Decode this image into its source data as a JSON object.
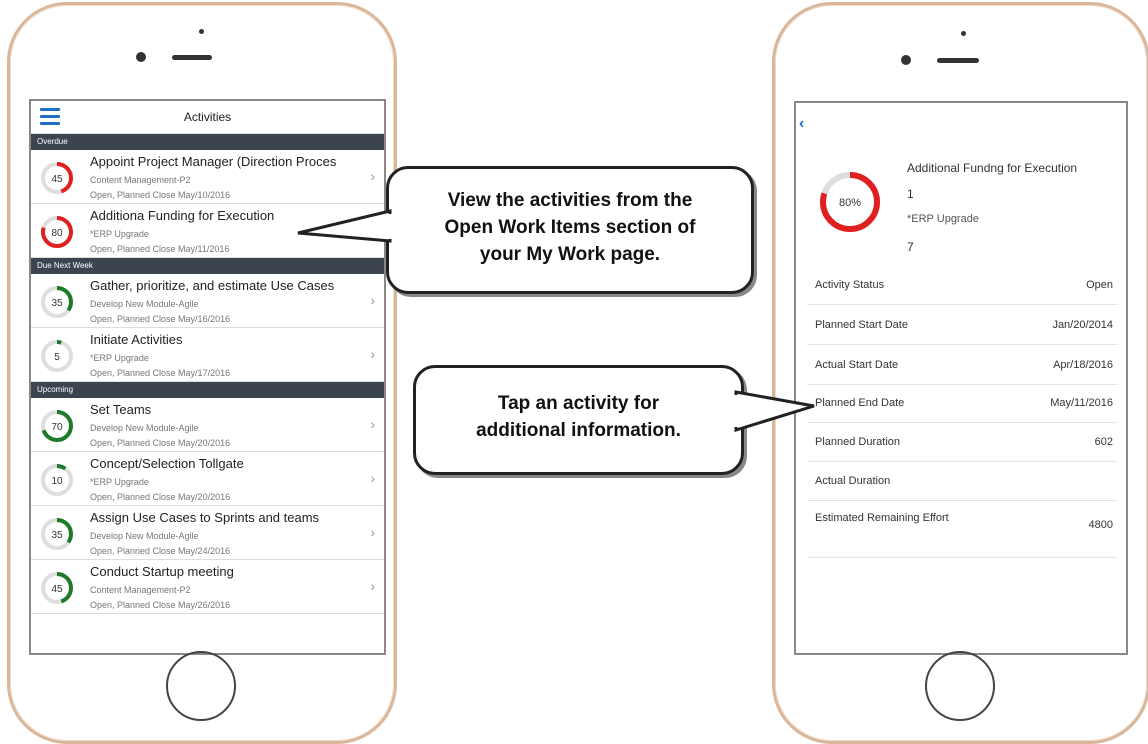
{
  "left_screen": {
    "title": "Activities",
    "sections": [
      {
        "label": "Overdue",
        "items": [
          {
            "title": "Appoint Project Manager (Direction Proces",
            "subtitle": "Content Management-P2",
            "status": "Open, Planned Close May/10/2016",
            "progress": 45,
            "ring_color": "#e02020"
          },
          {
            "title": "Additiona Funding for Execution",
            "subtitle": "*ERP Upgrade",
            "status": "Open, Planned Close May/11/2016",
            "progress": 80,
            "ring_color": "#e02020"
          }
        ]
      },
      {
        "label": "Due Next Week",
        "items": [
          {
            "title": "Gather, prioritize, and estimate Use Cases",
            "subtitle": "Develop New Module-Agile",
            "status": "Open, Planned Close May/16/2016",
            "progress": 35,
            "ring_color": "#1e7a2a"
          },
          {
            "title": "Initiate Activities",
            "subtitle": "*ERP Upgrade",
            "status": "Open, Planned Close May/17/2016",
            "progress": 5,
            "ring_color": "#1e7a2a"
          }
        ]
      },
      {
        "label": "Upcoming",
        "items": [
          {
            "title": "Set Teams",
            "subtitle": "Develop New Module-Agile",
            "status": "Open, Planned Close May/20/2016",
            "progress": 70,
            "ring_color": "#1e7a2a"
          },
          {
            "title": "Concept/Selection Tollgate",
            "subtitle": "*ERP Upgrade",
            "status": "Open, Planned Close May/20/2016",
            "progress": 10,
            "ring_color": "#1e7a2a"
          },
          {
            "title": "Assign Use Cases to Sprints and teams",
            "subtitle": "Develop New Module-Agile",
            "status": "Open, Planned Close May/24/2016",
            "progress": 35,
            "ring_color": "#1e7a2a"
          },
          {
            "title": "Conduct Startup meeting",
            "subtitle": "Content Management-P2",
            "status": "Open, Planned Close May/26/2016",
            "progress": 45,
            "ring_color": "#1e7a2a"
          }
        ]
      }
    ]
  },
  "callouts": {
    "first": [
      "View the activities from the",
      "Open Work Items section of",
      "your My Work page."
    ],
    "second": [
      "Tap an activity for",
      "additional information."
    ]
  },
  "right_screen": {
    "back_icon": "chevron-left-icon",
    "progress_label": "80%",
    "progress": 80,
    "ring_color": "#e02020",
    "title": "Additional Fundng for Execution",
    "line1": "1",
    "project": "*ERP Upgrade",
    "line2": "7",
    "fields": [
      {
        "label": "Activity Status",
        "value": "Open"
      },
      {
        "label": "Planned Start Date",
        "value": "Jan/20/2014"
      },
      {
        "label": "Actual Start Date",
        "value": "Apr/18/2016"
      },
      {
        "label": "Planned End Date",
        "value": "May/11/2016"
      },
      {
        "label": "Planned Duration",
        "value": "602"
      },
      {
        "label": "Actual Duration",
        "value": ""
      },
      {
        "label": "Estimated Remaining Effort",
        "value": "4800"
      }
    ]
  }
}
